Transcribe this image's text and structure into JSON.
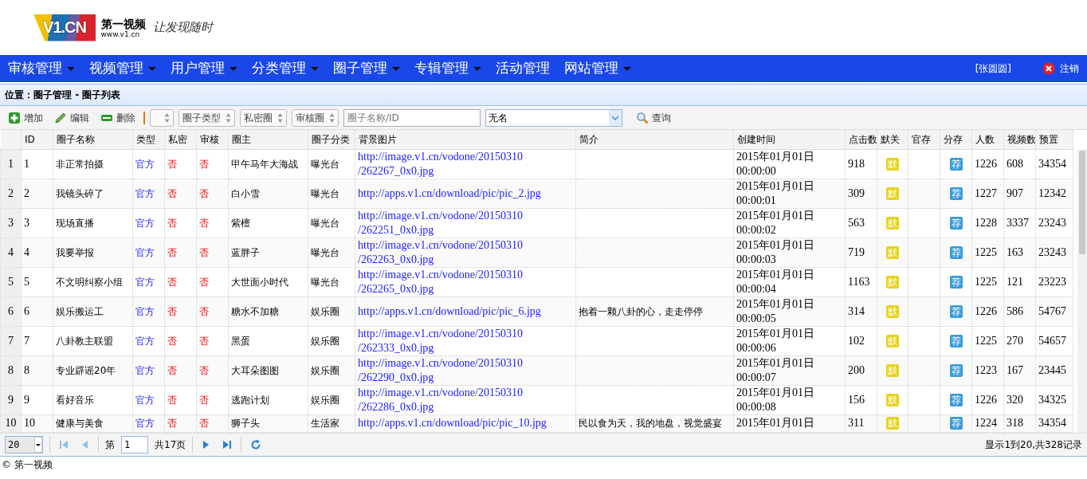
{
  "header": {
    "logo_text": "V1.CN",
    "brand": "第一视频",
    "url": "www.v1.cn",
    "slogan": "让发现随时"
  },
  "nav": {
    "items": [
      {
        "label": "审核管理",
        "has_menu": true
      },
      {
        "label": "视频管理",
        "has_menu": true
      },
      {
        "label": "用户管理",
        "has_menu": true
      },
      {
        "label": "分类管理",
        "has_menu": true
      },
      {
        "label": "圈子管理",
        "has_menu": true
      },
      {
        "label": "专辑管理",
        "has_menu": true
      },
      {
        "label": "活动管理",
        "has_menu": false
      },
      {
        "label": "网站管理",
        "has_menu": true
      }
    ],
    "user": "[张圆圆]",
    "logout": "注销"
  },
  "breadcrumb": "位置：圈子管理 - 圈子列表",
  "toolbar": {
    "buttons": [
      {
        "kind": "add",
        "label": "增加"
      },
      {
        "kind": "edit",
        "label": "编辑"
      },
      {
        "kind": "delete",
        "label": "删除"
      }
    ],
    "filters": [
      {
        "kind": "blank"
      },
      {
        "kind": "labeled",
        "label": "圈子类型"
      },
      {
        "kind": "labeled",
        "label": "私密圈"
      },
      {
        "kind": "labeled",
        "label": "审核圈"
      }
    ],
    "search_placeholder": "圈子名称/ID",
    "combo_value": "无名",
    "search_button": "查询"
  },
  "table": {
    "columns": [
      "",
      "ID",
      "圈子名称",
      "类型",
      "私密",
      "审核",
      "圈主",
      "圈子分类",
      "背景图片",
      "简介",
      "创建时间",
      "点击数",
      "默关",
      "官存",
      "分存",
      "人数",
      "视频数",
      "预置"
    ],
    "rows": [
      {
        "no": "1",
        "id": "1",
        "name": "非正常拍摄",
        "type": "官方",
        "private": "否",
        "audit": "否",
        "owner": "甲午马年大海战",
        "category": "曝光台",
        "image": "http://image.v1.cn/vodone/20150310/262267_0x0.jpg",
        "intro": "",
        "created": "2015年01月01日 00:00:00",
        "clicks": "918",
        "default_mark": "默",
        "recommend_mark": "荐",
        "members": "1226",
        "videos": "608",
        "preset": "34354"
      },
      {
        "no": "2",
        "id": "2",
        "name": "我镜头碎了",
        "type": "官方",
        "private": "否",
        "audit": "否",
        "owner": "白小雪",
        "category": "曝光台",
        "image": "http://apps.v1.cn/download/pic/pic_2.jpg",
        "intro": "",
        "created": "2015年01月01日 00:00:01",
        "clicks": "309",
        "default_mark": "默",
        "recommend_mark": "荐",
        "members": "1227",
        "videos": "907",
        "preset": "12342"
      },
      {
        "no": "3",
        "id": "3",
        "name": "现场直播",
        "type": "官方",
        "private": "否",
        "audit": "否",
        "owner": "紫檀",
        "category": "曝光台",
        "image": "http://image.v1.cn/vodone/20150310/262251_0x0.jpg",
        "intro": "",
        "created": "2015年01月01日 00:00:02",
        "clicks": "563",
        "default_mark": "默",
        "recommend_mark": "荐",
        "members": "1228",
        "videos": "3337",
        "preset": "23243"
      },
      {
        "no": "4",
        "id": "4",
        "name": "我要举报",
        "type": "官方",
        "private": "否",
        "audit": "否",
        "owner": "蓝胖子",
        "category": "曝光台",
        "image": "http://image.v1.cn/vodone/20150310/262263_0x0.jpg",
        "intro": "",
        "created": "2015年01月01日 00:00:03",
        "clicks": "719",
        "default_mark": "默",
        "recommend_mark": "荐",
        "members": "1225",
        "videos": "163",
        "preset": "23243"
      },
      {
        "no": "5",
        "id": "5",
        "name": "不文明纠察小组",
        "type": "官方",
        "private": "否",
        "audit": "否",
        "owner": "大世面小时代",
        "category": "曝光台",
        "image": "http://image.v1.cn/vodone/20150310/262265_0x0.jpg",
        "intro": "",
        "created": "2015年01月01日 00:00:04",
        "clicks": "1163",
        "default_mark": "默",
        "recommend_mark": "荐",
        "members": "1225",
        "videos": "121",
        "preset": "23223"
      },
      {
        "no": "6",
        "id": "6",
        "name": "娱乐搬运工",
        "type": "官方",
        "private": "否",
        "audit": "否",
        "owner": "糖水不加糖",
        "category": "娱乐圈",
        "image": "http://apps.v1.cn/download/pic/pic_6.jpg",
        "intro": "抱着一颗八卦的心，走走停停",
        "created": "2015年01月01日 00:00:05",
        "clicks": "314",
        "default_mark": "默",
        "recommend_mark": "荐",
        "members": "1226",
        "videos": "586",
        "preset": "54767"
      },
      {
        "no": "7",
        "id": "7",
        "name": "八卦教主联盟",
        "type": "官方",
        "private": "否",
        "audit": "否",
        "owner": "黑蛋",
        "category": "娱乐圈",
        "image": "http://image.v1.cn/vodone/20150310/262333_0x0.jpg",
        "intro": "",
        "created": "2015年01月01日 00:00:06",
        "clicks": "102",
        "default_mark": "默",
        "recommend_mark": "荐",
        "members": "1225",
        "videos": "270",
        "preset": "54657"
      },
      {
        "no": "8",
        "id": "8",
        "name": "专业辟谣20年",
        "type": "官方",
        "private": "否",
        "audit": "否",
        "owner": "大耳朵图图",
        "category": "娱乐圈",
        "image": "http://image.v1.cn/vodone/20150310/262290_0x0.jpg",
        "intro": "",
        "created": "2015年01月01日 00:00:07",
        "clicks": "200",
        "default_mark": "默",
        "recommend_mark": "荐",
        "members": "1223",
        "videos": "167",
        "preset": "23445"
      },
      {
        "no": "9",
        "id": "9",
        "name": "看好音乐",
        "type": "官方",
        "private": "否",
        "audit": "否",
        "owner": "逃跑计划",
        "category": "娱乐圈",
        "image": "http://image.v1.cn/vodone/20150310/262286_0x0.jpg",
        "intro": "",
        "created": "2015年01月01日 00:00:08",
        "clicks": "156",
        "default_mark": "默",
        "recommend_mark": "荐",
        "members": "1226",
        "videos": "320",
        "preset": "34325"
      },
      {
        "no": "10",
        "id": "10",
        "name": "健康与美食",
        "type": "官方",
        "private": "否",
        "audit": "否",
        "owner": "狮子头",
        "category": "生活家",
        "image": "http://apps.v1.cn/download/pic/pic_10.jpg",
        "intro": "民以食为天，我的地盘，视觉盛宴",
        "created": "2015年01月01日",
        "clicks": "311",
        "default_mark": "默",
        "recommend_mark": "荐",
        "members": "1224",
        "videos": "318",
        "preset": "34354"
      }
    ]
  },
  "pager": {
    "page_size": "20",
    "page_label": "第",
    "page": "1",
    "total_pages": "共17页",
    "summary": "显示1到20,共328记录"
  },
  "footer": "© 第一视频"
}
